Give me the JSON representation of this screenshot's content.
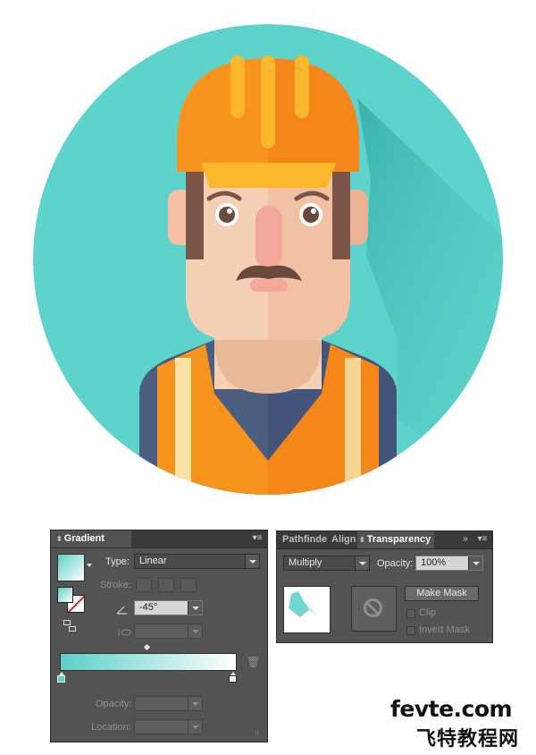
{
  "illustration": {
    "subject": "construction worker avatar",
    "colors": {
      "background_circle": "#5dd3cc",
      "long_shadow": "#3fb8b2",
      "helmet": "#f7941d",
      "helmet_brim": "#fbb72b",
      "skin": "#f6d0b5",
      "hair": "#7a5548",
      "vest": "#f7941d",
      "shirt": "#4b5e7f"
    }
  },
  "gradient_panel": {
    "tab_label": "Gradient",
    "type_label": "Type:",
    "type_value": "Linear",
    "stroke_label": "Stroke:",
    "angle_value": "-45°",
    "opacity_label": "Opacity:",
    "location_label": "Location:",
    "gradient_colors": {
      "start": "#5ccfc8",
      "end": "#ffffff"
    }
  },
  "transparency_panel": {
    "tabs": [
      "Pathfinde",
      "Align",
      "Transparency"
    ],
    "blend_mode": "Multiply",
    "opacity_label": "Opacity:",
    "opacity_value": "100%",
    "make_mask_label": "Make Mask",
    "clip_label": "Clip",
    "invert_mask_label": "Invert Mask"
  },
  "watermark": {
    "line1": "fevte.com",
    "line2": "飞特教程网"
  }
}
